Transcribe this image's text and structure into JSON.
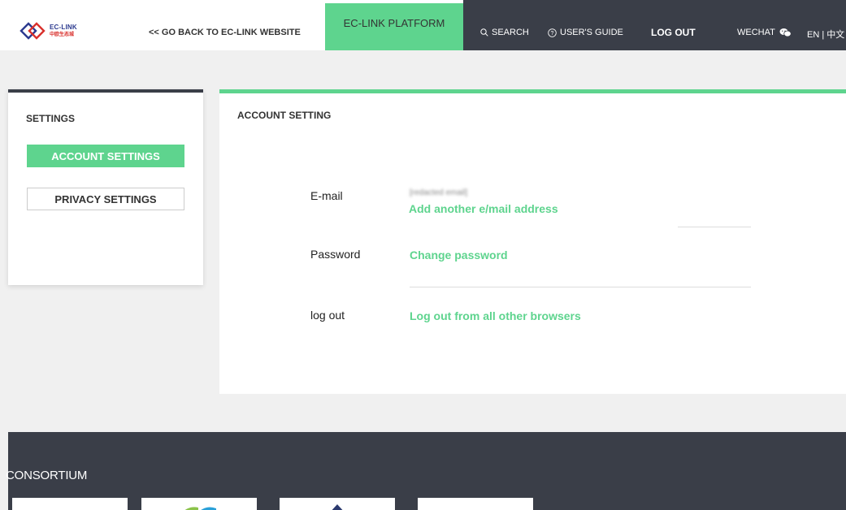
{
  "header": {
    "logo": {
      "text_en": "EC-LINK",
      "text_cn": "中欧生态城",
      "icon": "ec-link-logo-icon"
    },
    "back_link": "<< GO BACK TO EC-LINK WEBSITE",
    "nav": {
      "platform": "EC-LINK PLATFORM",
      "search": "SEARCH",
      "guide": "USER'S GUIDE",
      "logout": "LOG OUT",
      "wechat": "WECHAT",
      "language": "EN | 中文"
    }
  },
  "sidebar": {
    "title": "SETTINGS",
    "items": [
      {
        "label": "ACCOUNT SETTINGS",
        "active": true
      },
      {
        "label": "PRIVACY SETTINGS",
        "active": false
      }
    ]
  },
  "main": {
    "title": "ACCOUNT SETTING",
    "rows": [
      {
        "label": "E-mail",
        "value": "[redacted email]",
        "link": "Add another e/mail address"
      },
      {
        "label": "Password",
        "link": "Change password"
      },
      {
        "label": "log out",
        "link": "Log out from all other browsers"
      }
    ]
  },
  "footer": {
    "title": "CONSORTIUM"
  },
  "colors": {
    "accent_green": "#5ed48e",
    "dark_slate": "#3a3e48",
    "page_bg": "#f0f0f0"
  }
}
